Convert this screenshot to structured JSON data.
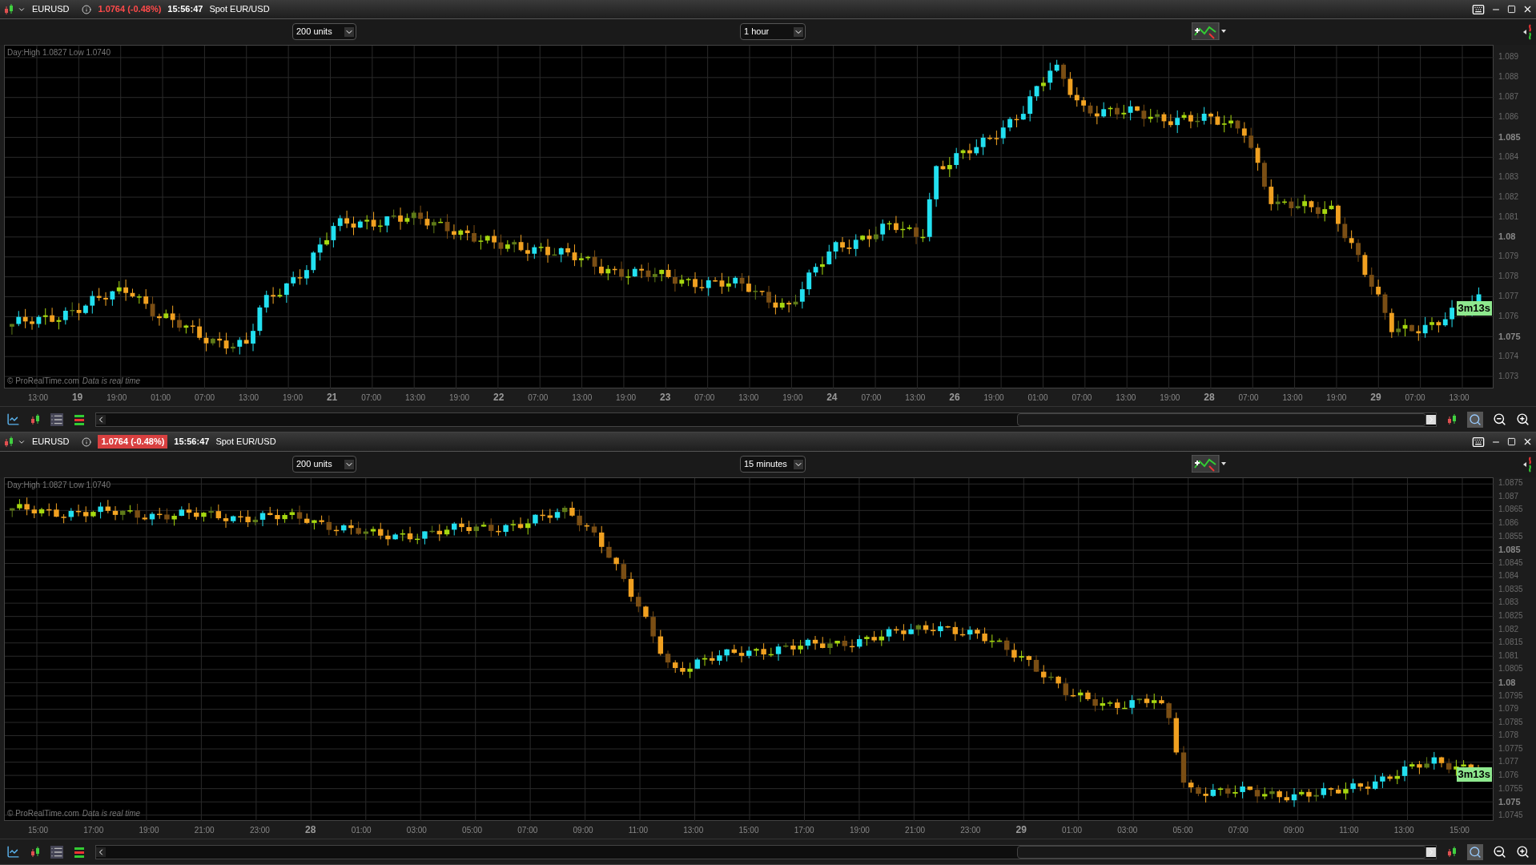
{
  "panels": [
    {
      "symbol": "EURUSD",
      "price_change": "1.0764 (-0.48%)",
      "price_highlighted": false,
      "time": "15:56:47",
      "instrument": "Spot EUR/USD",
      "units": "200 units",
      "timeframe": "1 hour",
      "day_range": "Day:High 1.0827 Low 1.0740",
      "copyright": "© ProRealTime.com",
      "data_note": "Data is real time",
      "countdown": "3m13s",
      "y_ticks": [
        {
          "label": "1.089",
          "major": false
        },
        {
          "label": "1.088",
          "major": false
        },
        {
          "label": "1.087",
          "major": false
        },
        {
          "label": "1.086",
          "major": false
        },
        {
          "label": "1.085",
          "major": true
        },
        {
          "label": "1.084",
          "major": false
        },
        {
          "label": "1.083",
          "major": false
        },
        {
          "label": "1.082",
          "major": false
        },
        {
          "label": "1.081",
          "major": false
        },
        {
          "label": "1.08",
          "major": true
        },
        {
          "label": "1.079",
          "major": false
        },
        {
          "label": "1.078",
          "major": false
        },
        {
          "label": "1.077",
          "major": false
        },
        {
          "label": "1.076",
          "major": false
        },
        {
          "label": "1.075",
          "major": true
        },
        {
          "label": "1.074",
          "major": false
        },
        {
          "label": "1.073",
          "major": false
        }
      ],
      "x_ticks": [
        {
          "label": "13:00",
          "kind": "time"
        },
        {
          "label": "19",
          "kind": "day"
        },
        {
          "label": "19:00",
          "kind": "time"
        },
        {
          "label": "01:00",
          "kind": "time"
        },
        {
          "label": "07:00",
          "kind": "time"
        },
        {
          "label": "13:00",
          "kind": "time"
        },
        {
          "label": "19:00",
          "kind": "time"
        },
        {
          "label": "21",
          "kind": "day"
        },
        {
          "label": "07:00",
          "kind": "time"
        },
        {
          "label": "13:00",
          "kind": "time"
        },
        {
          "label": "19:00",
          "kind": "time"
        },
        {
          "label": "22",
          "kind": "day"
        },
        {
          "label": "07:00",
          "kind": "time"
        },
        {
          "label": "13:00",
          "kind": "time"
        },
        {
          "label": "19:00",
          "kind": "time"
        },
        {
          "label": "23",
          "kind": "day"
        },
        {
          "label": "07:00",
          "kind": "time"
        },
        {
          "label": "13:00",
          "kind": "time"
        },
        {
          "label": "19:00",
          "kind": "time"
        },
        {
          "label": "24",
          "kind": "day"
        },
        {
          "label": "07:00",
          "kind": "time"
        },
        {
          "label": "13:00",
          "kind": "time"
        },
        {
          "label": "26",
          "kind": "day"
        },
        {
          "label": "19:00",
          "kind": "time"
        },
        {
          "label": "01:00",
          "kind": "time"
        },
        {
          "label": "07:00",
          "kind": "time"
        },
        {
          "label": "13:00",
          "kind": "time"
        },
        {
          "label": "19:00",
          "kind": "time"
        },
        {
          "label": "28",
          "kind": "day"
        },
        {
          "label": "07:00",
          "kind": "time"
        },
        {
          "label": "13:00",
          "kind": "time"
        },
        {
          "label": "19:00",
          "kind": "time"
        },
        {
          "label": "29",
          "kind": "day"
        },
        {
          "label": "07:00",
          "kind": "time"
        },
        {
          "label": "13:00",
          "kind": "time"
        }
      ]
    },
    {
      "symbol": "EURUSD",
      "price_change": "1.0764 (-0.48%)",
      "price_highlighted": true,
      "time": "15:56:47",
      "instrument": "Spot EUR/USD",
      "units": "200 units",
      "timeframe": "15 minutes",
      "day_range": "Day:High 1.0827 Low 1.0740",
      "copyright": "© ProRealTime.com",
      "data_note": "Data is real time",
      "countdown": "3m13s",
      "y_ticks": [
        {
          "label": "1.0875",
          "major": false
        },
        {
          "label": "1.087",
          "major": false
        },
        {
          "label": "1.0865",
          "major": false
        },
        {
          "label": "1.086",
          "major": false
        },
        {
          "label": "1.0855",
          "major": false
        },
        {
          "label": "1.085",
          "major": true
        },
        {
          "label": "1.0845",
          "major": false
        },
        {
          "label": "1.084",
          "major": false
        },
        {
          "label": "1.0835",
          "major": false
        },
        {
          "label": "1.083",
          "major": false
        },
        {
          "label": "1.0825",
          "major": false
        },
        {
          "label": "1.082",
          "major": false
        },
        {
          "label": "1.0815",
          "major": false
        },
        {
          "label": "1.081",
          "major": false
        },
        {
          "label": "1.0805",
          "major": false
        },
        {
          "label": "1.08",
          "major": true
        },
        {
          "label": "1.0795",
          "major": false
        },
        {
          "label": "1.079",
          "major": false
        },
        {
          "label": "1.0785",
          "major": false
        },
        {
          "label": "1.078",
          "major": false
        },
        {
          "label": "1.0775",
          "major": false
        },
        {
          "label": "1.077",
          "major": false
        },
        {
          "label": "1.076",
          "major": false
        },
        {
          "label": "1.0755",
          "major": false
        },
        {
          "label": "1.075",
          "major": true
        },
        {
          "label": "1.0745",
          "major": false
        }
      ],
      "x_ticks": [
        {
          "label": "15:00",
          "kind": "time"
        },
        {
          "label": "17:00",
          "kind": "time"
        },
        {
          "label": "19:00",
          "kind": "time"
        },
        {
          "label": "21:00",
          "kind": "time"
        },
        {
          "label": "23:00",
          "kind": "time"
        },
        {
          "label": "28",
          "kind": "day"
        },
        {
          "label": "01:00",
          "kind": "time"
        },
        {
          "label": "03:00",
          "kind": "time"
        },
        {
          "label": "05:00",
          "kind": "time"
        },
        {
          "label": "07:00",
          "kind": "time"
        },
        {
          "label": "09:00",
          "kind": "time"
        },
        {
          "label": "11:00",
          "kind": "time"
        },
        {
          "label": "13:00",
          "kind": "time"
        },
        {
          "label": "15:00",
          "kind": "time"
        },
        {
          "label": "17:00",
          "kind": "time"
        },
        {
          "label": "19:00",
          "kind": "time"
        },
        {
          "label": "21:00",
          "kind": "time"
        },
        {
          "label": "23:00",
          "kind": "time"
        },
        {
          "label": "29",
          "kind": "day"
        },
        {
          "label": "01:00",
          "kind": "time"
        },
        {
          "label": "03:00",
          "kind": "time"
        },
        {
          "label": "05:00",
          "kind": "time"
        },
        {
          "label": "07:00",
          "kind": "time"
        },
        {
          "label": "09:00",
          "kind": "time"
        },
        {
          "label": "11:00",
          "kind": "time"
        },
        {
          "label": "13:00",
          "kind": "time"
        },
        {
          "label": "15:00",
          "kind": "time"
        }
      ]
    }
  ]
}
